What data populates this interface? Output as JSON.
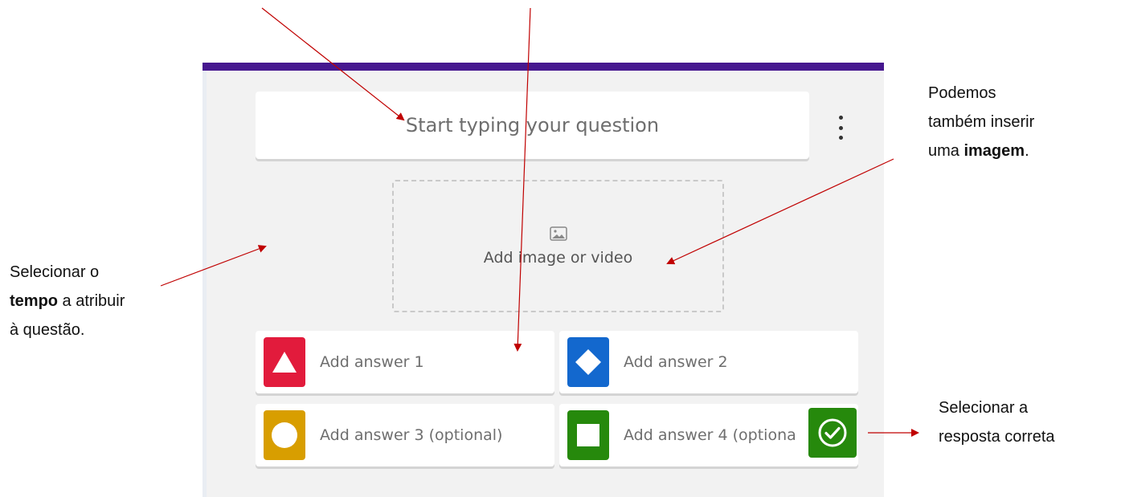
{
  "editor": {
    "question_placeholder": "Start typing your question",
    "media_label": "Add image or video",
    "answers": [
      {
        "label": "Add answer 1",
        "color": "#e21b3c",
        "shape": "triangle-icon"
      },
      {
        "label": "Add answer 2",
        "color": "#1368ce",
        "shape": "diamond-icon"
      },
      {
        "label": "Add answer 3 (optional)",
        "color": "#d89e00",
        "shape": "circle-icon"
      },
      {
        "label": "Add answer 4 (optiona",
        "color": "#26890c",
        "shape": "square-icon"
      }
    ],
    "accent_color": "#46178f",
    "correct_color": "#26890c"
  },
  "annotations": {
    "image_note": {
      "line1": "Podemos",
      "line2": "também inserir",
      "line3_pre": "uma ",
      "line3_bold": "imagem",
      "line3_post": "."
    },
    "time_note": {
      "line1": "Selecionar o",
      "line2_bold": "tempo",
      "line2_post": " a atribuir",
      "line3": "à questão."
    },
    "answer_note": {
      "line1": "Selecionar a",
      "line2": "resposta correta"
    }
  }
}
